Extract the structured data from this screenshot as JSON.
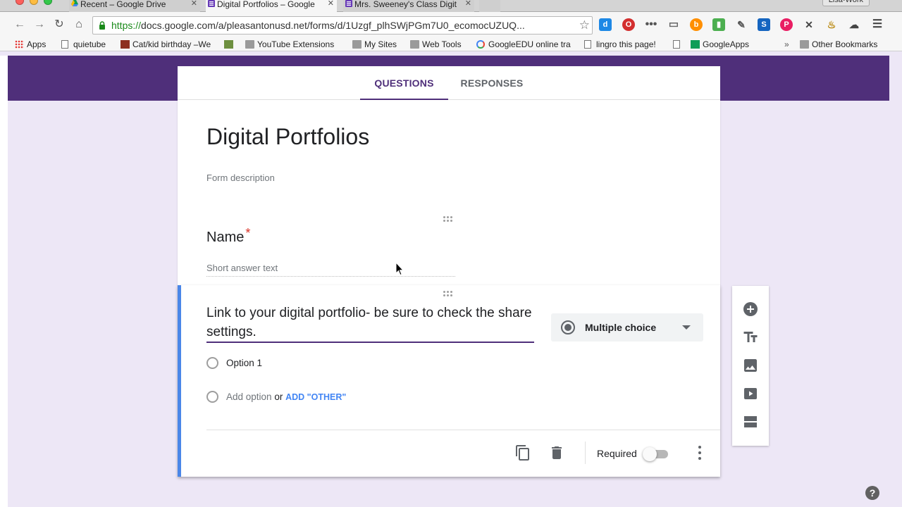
{
  "browser": {
    "tabs": [
      {
        "title": "Recent – Google Drive",
        "active": false
      },
      {
        "title": "Digital Portfolios – Google",
        "active": true
      },
      {
        "title": "Mrs. Sweeney's Class Digit",
        "active": false
      }
    ],
    "profile": "Lisa-Work",
    "url_scheme": "https://",
    "url_rest": "docs.google.com/a/pleasantonusd.net/forms/d/1Uzgf_plhSWjPGm7U0_ecomocUZUQ...",
    "bookmarks": [
      {
        "label": "Apps",
        "icon": "apps-grid-icon"
      },
      {
        "label": "quietube",
        "icon": "page-icon"
      },
      {
        "label": "Cat/kid birthday –We",
        "icon": "site-icon"
      },
      {
        "label": "",
        "icon": "site-icon"
      },
      {
        "label": "YouTube Extensions",
        "icon": "folder-icon"
      },
      {
        "label": "My Sites",
        "icon": "folder-icon"
      },
      {
        "label": "Web Tools",
        "icon": "folder-icon"
      },
      {
        "label": "GoogleEDU online tra",
        "icon": "google-icon"
      },
      {
        "label": "lingro this page!",
        "icon": "page-icon"
      },
      {
        "label": "",
        "icon": "page-icon"
      },
      {
        "label": "GoogleApps",
        "icon": "sheets-icon"
      },
      {
        "label": "Other Bookmarks",
        "icon": "folder-icon"
      }
    ],
    "bookmarks_overflow": "»"
  },
  "form": {
    "tabs": {
      "questions": "QUESTIONS",
      "responses": "RESPONSES"
    },
    "title": "Digital Portfolios",
    "description_placeholder": "Form description",
    "question1": {
      "title": "Name",
      "required_mark": "*",
      "answer_placeholder": "Short answer text"
    },
    "question2": {
      "title": "Link to your digital portfolio- be sure to check the share settings.",
      "type": "Multiple choice",
      "option1": "Option 1",
      "add_option": "Add option",
      "or": "or",
      "add_other": "ADD \"OTHER\"",
      "required_label": "Required",
      "required_on": false
    },
    "help": "?"
  },
  "colors": {
    "theme": "#4f2f7a",
    "background": "#ede7f6",
    "accent_blue": "#4a86e8"
  }
}
